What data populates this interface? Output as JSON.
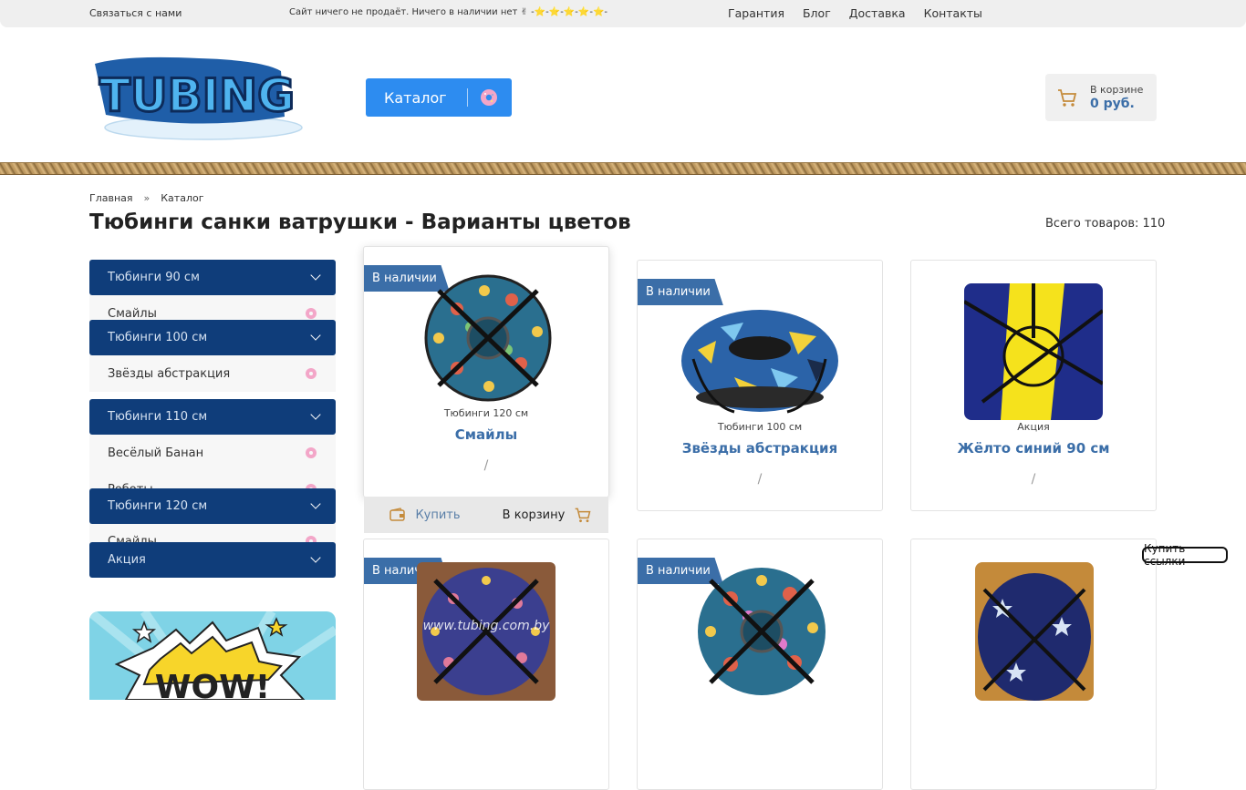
{
  "topbar": {
    "contact": "Связаться с нами",
    "notice": "Сайт ничего не продаёт. Ничего в наличии нет ✌ -⭐-⭐-⭐-⭐-⭐-",
    "nav": [
      "Гарантия",
      "Блог",
      "Доставка",
      "Контакты"
    ]
  },
  "header": {
    "logo_text": "TUBING",
    "catalog_label": "Каталог",
    "cart_label": "В корзине",
    "cart_sum": "0 руб."
  },
  "breadcrumbs": [
    "Главная",
    "»",
    "Каталог"
  ],
  "page_title": "Тюбинги санки ватрушки - Варианты цветов",
  "total": "Всего товаров: 110",
  "sidebar": {
    "groups": [
      {
        "title": "Тюбинги 90 см",
        "item": "Смайлы"
      },
      {
        "title": "Тюбинги 100 см",
        "item": "Звёзды абстракция"
      },
      {
        "title": "Тюбинги 110 см",
        "item": "Весёлый Банан",
        "item2": "Роботы"
      },
      {
        "title": "Тюбинги 120 см",
        "item": "Смайлы"
      },
      {
        "title": "Акция"
      }
    ],
    "promo_text": "WOW!"
  },
  "products": [
    {
      "badge": "В наличии",
      "category": "Тюбинги 120 см",
      "name": "Смайлы",
      "price": "/"
    },
    {
      "badge": "В наличии",
      "category": "Тюбинги 100 см",
      "name": "Звёзды абстракция",
      "price": "/"
    },
    {
      "badge": "",
      "category": "Акция",
      "name": "Жёлто синий 90 см",
      "price": "/"
    },
    {
      "badge": "В наличии",
      "watermark": "www.tubing.com.by"
    },
    {
      "badge": "В наличии"
    },
    {
      "badge": ""
    }
  ],
  "buybar": {
    "buy": "Купить",
    "tocart": "В корзину"
  },
  "buy_links": "Купить ссылки",
  "colors": {
    "brand_blue": "#2d8cf0",
    "navy": "#0f3d7a",
    "accent": "#3b6ea8"
  }
}
